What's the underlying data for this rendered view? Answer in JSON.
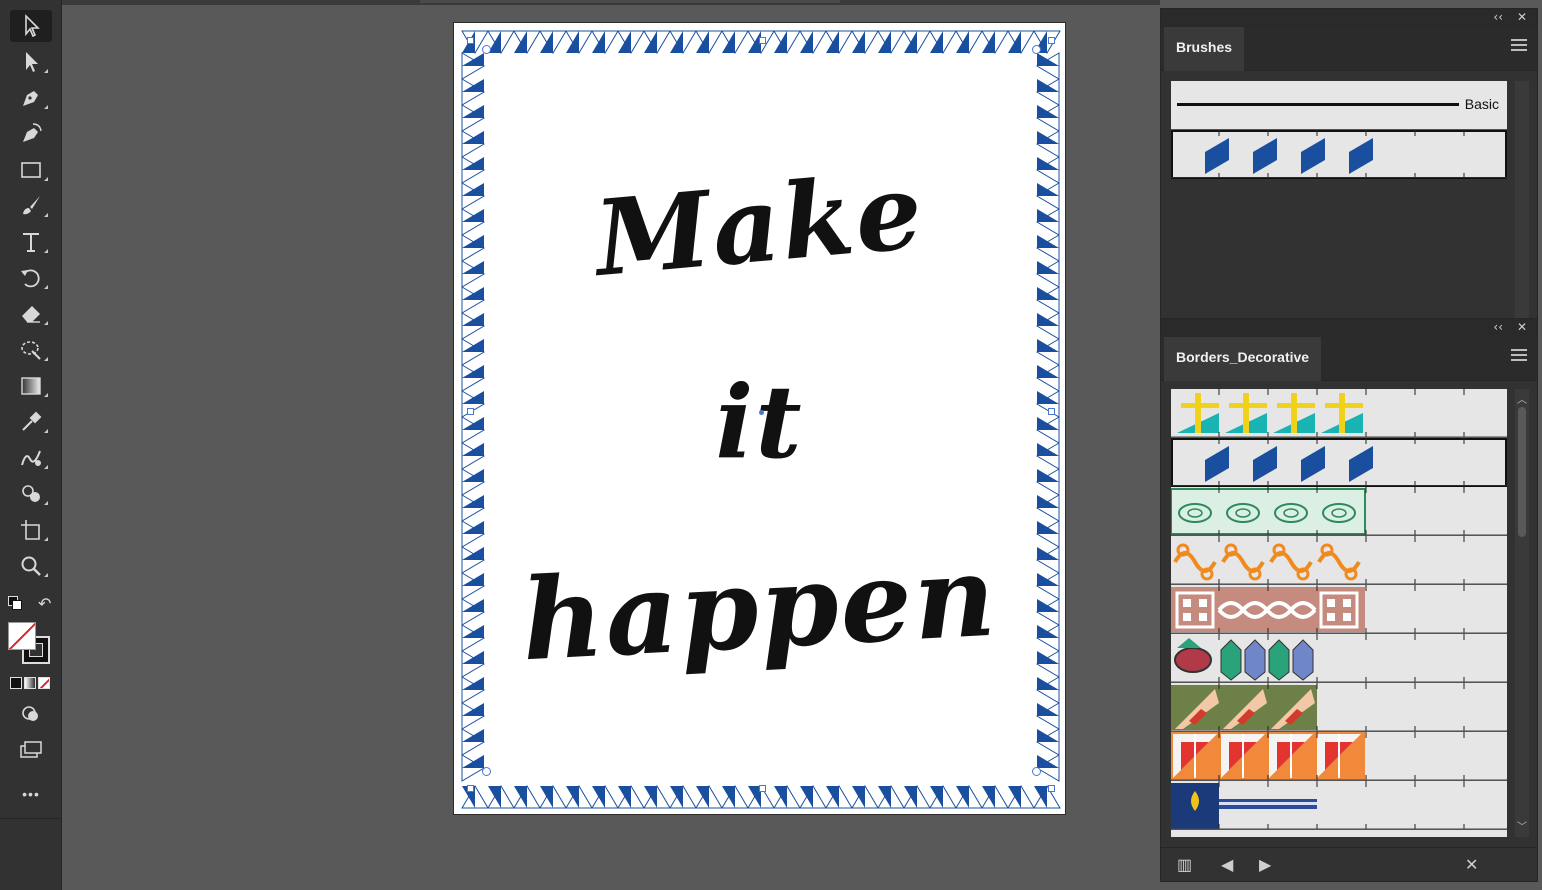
{
  "toolbar": {
    "tools": [
      {
        "name": "selection-tool",
        "icon": "selection-arrow-icon"
      },
      {
        "name": "direct-selection-tool",
        "icon": "direct-selection-arrow-icon"
      },
      {
        "name": "pen-tool",
        "icon": "pen-icon"
      },
      {
        "name": "curvature-tool",
        "icon": "curvature-pen-icon"
      },
      {
        "name": "rectangle-tool",
        "icon": "rectangle-icon"
      },
      {
        "name": "paintbrush-tool",
        "icon": "paintbrush-icon"
      },
      {
        "name": "type-tool",
        "icon": "type-icon"
      },
      {
        "name": "rotate-tool",
        "icon": "rotate-icon"
      },
      {
        "name": "eraser-tool",
        "icon": "eraser-icon"
      },
      {
        "name": "lasso-tool",
        "icon": "lasso-icon"
      },
      {
        "name": "gradient-tool",
        "icon": "gradient-icon"
      },
      {
        "name": "eyedropper-tool",
        "icon": "eyedropper-icon"
      },
      {
        "name": "blend-tool",
        "icon": "blend-icon"
      },
      {
        "name": "shape-builder-tool",
        "icon": "shape-builder-icon"
      },
      {
        "name": "artboard-tool",
        "icon": "artboard-icon"
      },
      {
        "name": "zoom-tool",
        "icon": "zoom-icon"
      }
    ],
    "more_label": "•••"
  },
  "artboard": {
    "lines": [
      "Make",
      "it",
      "happen"
    ],
    "border_color": "#1a4fa0"
  },
  "brushes_panel": {
    "tab_label": "Brushes",
    "basic_label": "Basic"
  },
  "borders_panel": {
    "tab_label": "Borders_Decorative"
  },
  "colors": {
    "accent_blue": "#1a4fa0",
    "ui_dark": "#323232",
    "canvas": "#595959"
  }
}
